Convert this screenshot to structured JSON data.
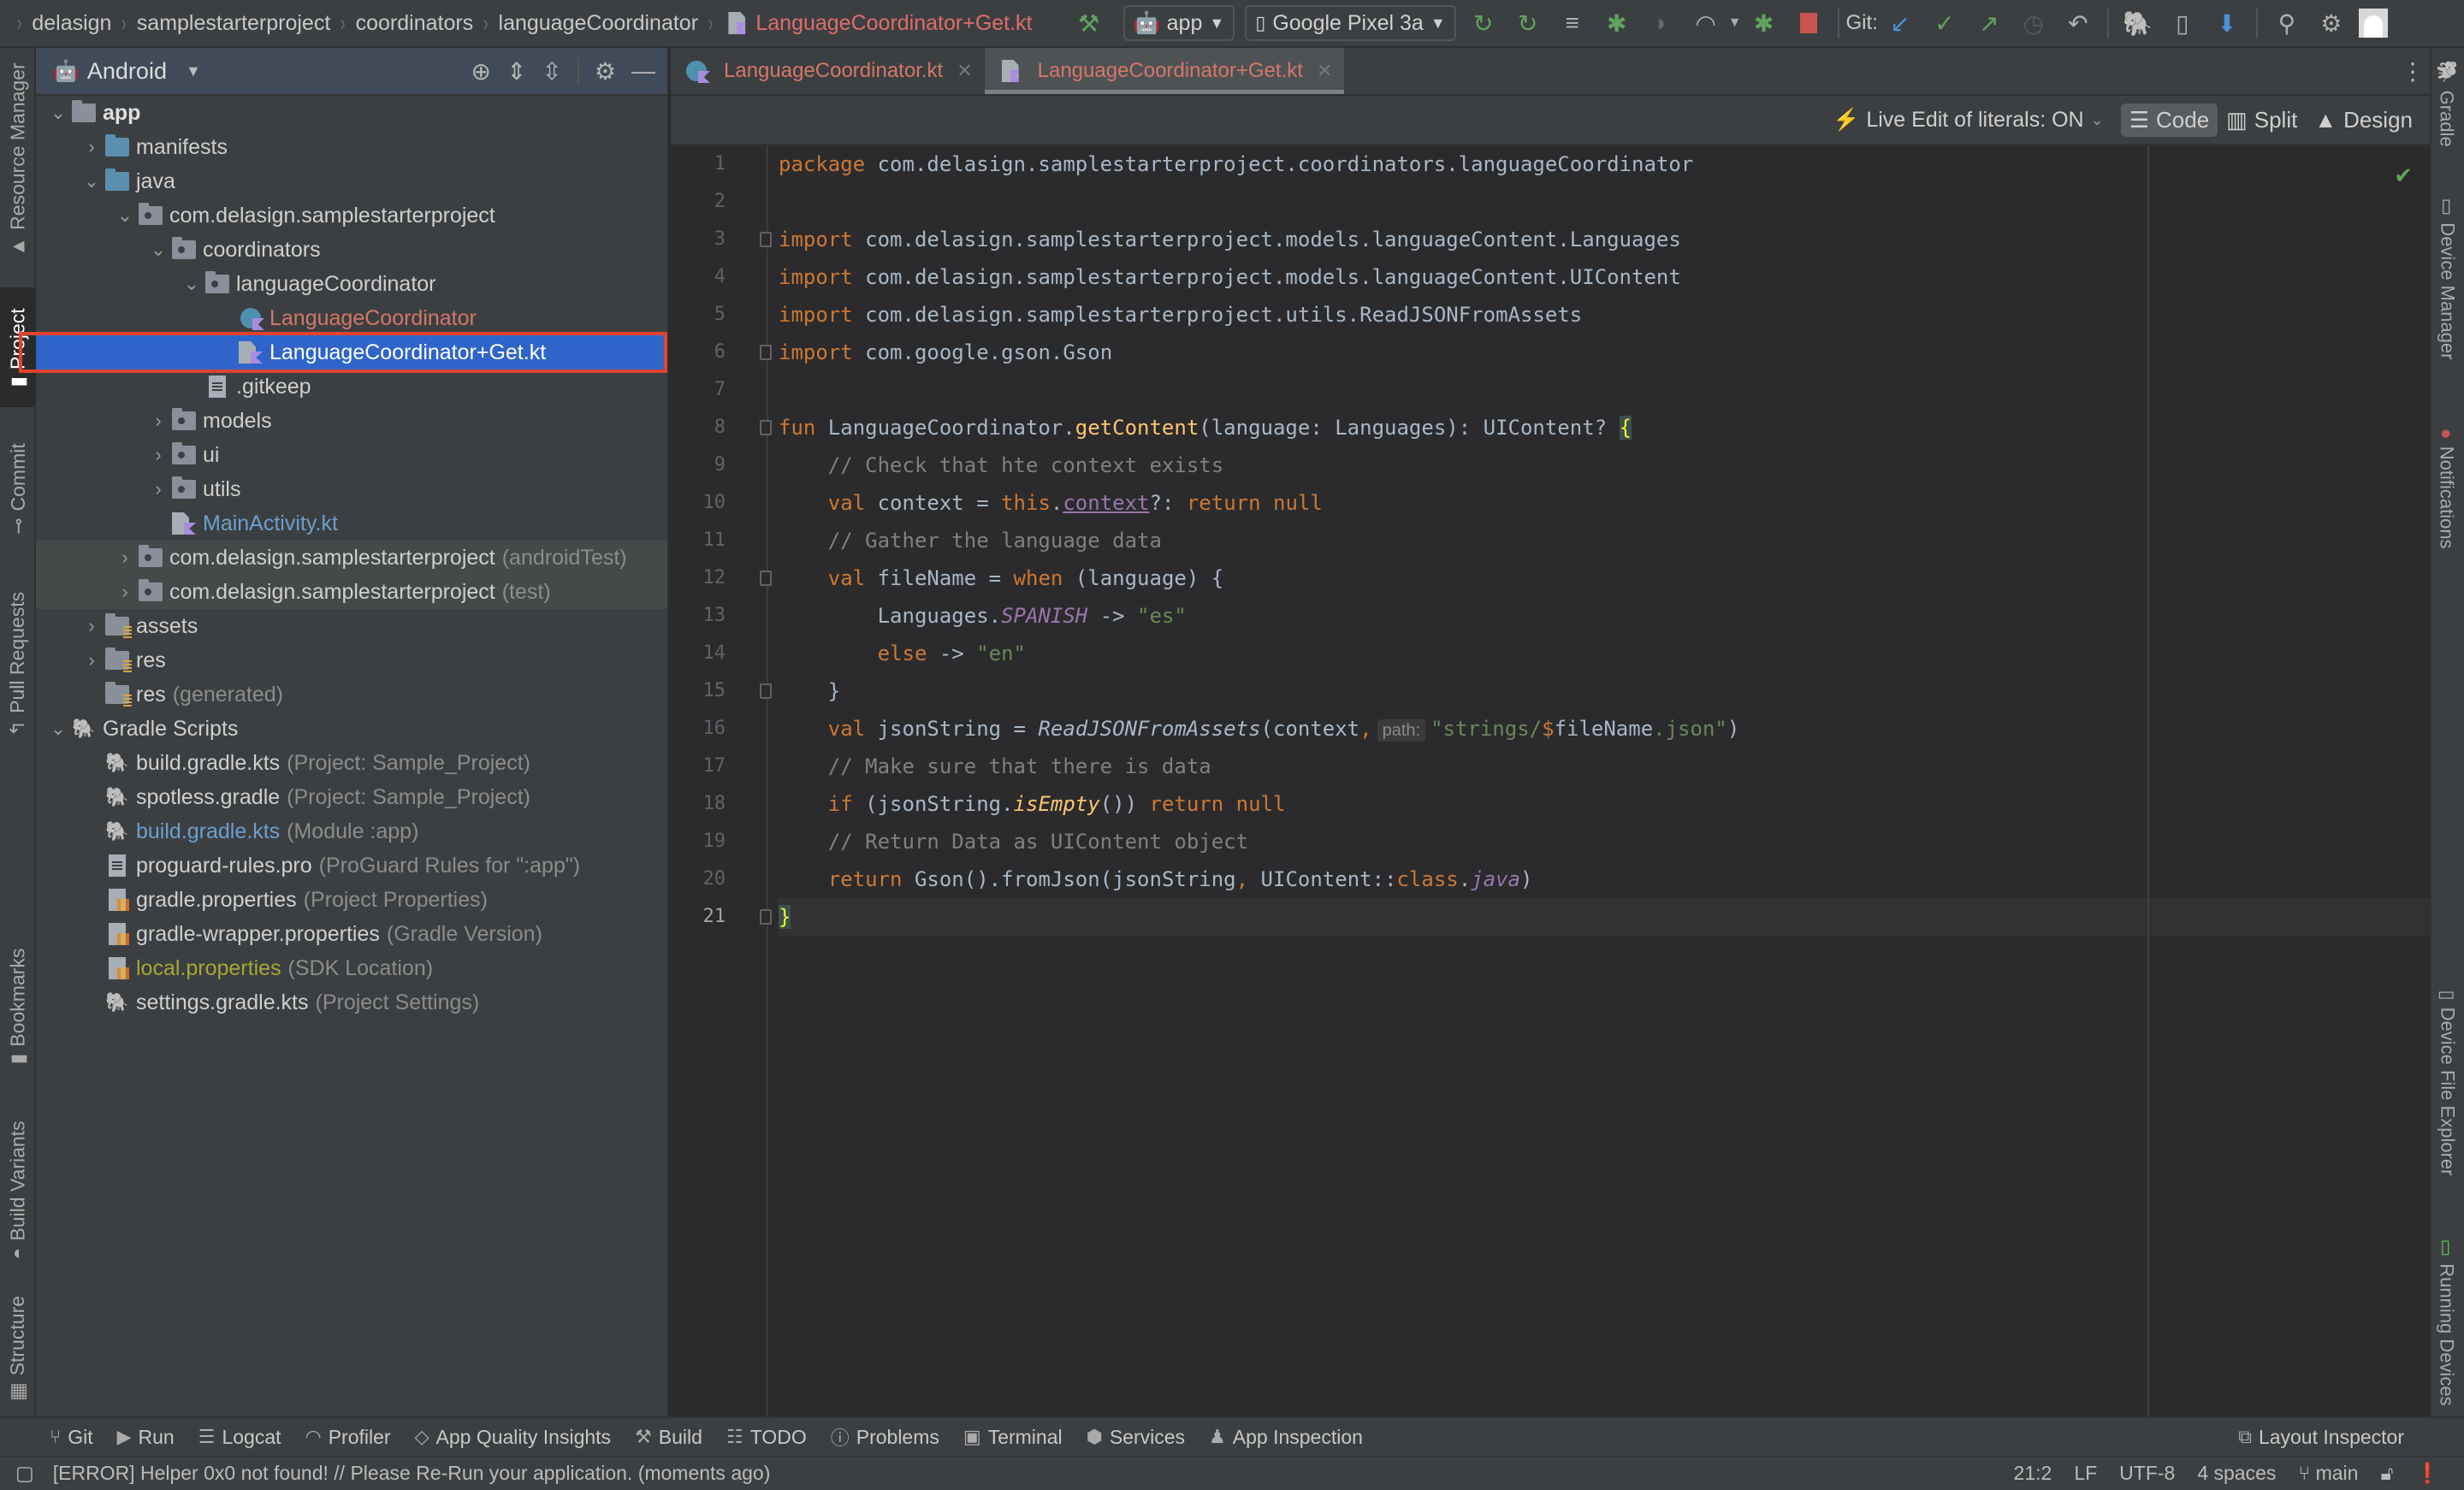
{
  "breadcrumbs": [
    "delasign",
    "samplestarterproject",
    "coordinators",
    "languageCoordinator",
    "LanguageCoordinator+Get.kt"
  ],
  "toolbar": {
    "run_config": "app",
    "device": "Google Pixel 3a",
    "git_label": "Git:",
    "icons": [
      "hammer-icon",
      "rerun-icon",
      "apply-changes-icon",
      "apply-code-changes-icon",
      "debug-icon",
      "attach-debugger-icon",
      "profile-icon",
      "attach-debug-icon",
      "stop-icon",
      "git-update-icon",
      "git-commit-icon",
      "git-push-icon",
      "history-icon",
      "rollback-icon",
      "gradle-sync-icon",
      "device-manager-icon",
      "sdk-manager-icon",
      "search-icon",
      "settings-icon",
      "avatar"
    ]
  },
  "left_tools": [
    "Resource Manager",
    "Project",
    "Commit",
    "Pull Requests",
    "Bookmarks",
    "Build Variants",
    "Structure"
  ],
  "right_tools": [
    "Gradle",
    "Device Manager",
    "Notifications",
    "Device File Explorer",
    "Running Devices"
  ],
  "project": {
    "view": "Android",
    "tree": [
      {
        "label": "app",
        "note": "",
        "depth": 0,
        "chev": "open",
        "icon": "module",
        "style": "bold"
      },
      {
        "label": "manifests",
        "note": "",
        "depth": 1,
        "chev": "closed",
        "icon": "src-folder",
        "style": ""
      },
      {
        "label": "java",
        "note": "",
        "depth": 1,
        "chev": "open",
        "icon": "src-folder",
        "style": ""
      },
      {
        "label": "com.delasign.samplestarterproject",
        "note": "",
        "depth": 2,
        "chev": "open",
        "icon": "package",
        "style": ""
      },
      {
        "label": "coordinators",
        "note": "",
        "depth": 3,
        "chev": "open",
        "icon": "package",
        "style": ""
      },
      {
        "label": "languageCoordinator",
        "note": "",
        "depth": 4,
        "chev": "open",
        "icon": "package",
        "style": ""
      },
      {
        "label": "LanguageCoordinator",
        "note": "",
        "depth": 5,
        "chev": "",
        "icon": "kotlin-class",
        "style": "red"
      },
      {
        "label": "LanguageCoordinator+Get.kt",
        "note": "",
        "depth": 5,
        "chev": "",
        "icon": "kotlin-file",
        "style": "selected"
      },
      {
        "label": ".gitkeep",
        "note": "",
        "depth": 4,
        "chev": "",
        "icon": "text-file",
        "style": ""
      },
      {
        "label": "models",
        "note": "",
        "depth": 3,
        "chev": "closed",
        "icon": "package",
        "style": ""
      },
      {
        "label": "ui",
        "note": "",
        "depth": 3,
        "chev": "closed",
        "icon": "package",
        "style": ""
      },
      {
        "label": "utils",
        "note": "",
        "depth": 3,
        "chev": "closed",
        "icon": "package",
        "style": ""
      },
      {
        "label": "MainActivity.kt",
        "note": "",
        "depth": 3,
        "chev": "",
        "icon": "kotlin-file",
        "style": "blue"
      },
      {
        "label": "com.delasign.samplestarterproject",
        "note": "(androidTest)",
        "depth": 2,
        "chev": "closed",
        "icon": "package",
        "style": "dim"
      },
      {
        "label": "com.delasign.samplestarterproject",
        "note": "(test)",
        "depth": 2,
        "chev": "closed",
        "icon": "package",
        "style": "dim"
      },
      {
        "label": "assets",
        "note": "",
        "depth": 1,
        "chev": "closed",
        "icon": "res-folder",
        "style": ""
      },
      {
        "label": "res",
        "note": "",
        "depth": 1,
        "chev": "closed",
        "icon": "res-folder",
        "style": ""
      },
      {
        "label": "res",
        "note": "(generated)",
        "depth": 1,
        "chev": "",
        "icon": "res-folder",
        "style": ""
      },
      {
        "label": "Gradle Scripts",
        "note": "",
        "depth": 0,
        "chev": "open",
        "icon": "gradle",
        "style": ""
      },
      {
        "label": "build.gradle.kts",
        "note": "(Project: Sample_Project)",
        "depth": 1,
        "chev": "",
        "icon": "gradle",
        "style": ""
      },
      {
        "label": "spotless.gradle",
        "note": "(Project: Sample_Project)",
        "depth": 1,
        "chev": "",
        "icon": "gradle",
        "style": ""
      },
      {
        "label": "build.gradle.kts",
        "note": "(Module :app)",
        "depth": 1,
        "chev": "",
        "icon": "gradle",
        "style": "blue"
      },
      {
        "label": "proguard-rules.pro",
        "note": "(ProGuard Rules for \":app\")",
        "depth": 1,
        "chev": "",
        "icon": "text-file",
        "style": ""
      },
      {
        "label": "gradle.properties",
        "note": "(Project Properties)",
        "depth": 1,
        "chev": "",
        "icon": "properties",
        "style": ""
      },
      {
        "label": "gradle-wrapper.properties",
        "note": "(Gradle Version)",
        "depth": 1,
        "chev": "",
        "icon": "properties",
        "style": ""
      },
      {
        "label": "local.properties",
        "note": "(SDK Location)",
        "depth": 1,
        "chev": "",
        "icon": "properties",
        "style": "olive"
      },
      {
        "label": "settings.gradle.kts",
        "note": "(Project Settings)",
        "depth": 1,
        "chev": "",
        "icon": "gradle",
        "style": ""
      }
    ]
  },
  "tabs": [
    {
      "label": "LanguageCoordinator.kt",
      "active": false
    },
    {
      "label": "LanguageCoordinator+Get.kt",
      "active": true
    }
  ],
  "editor_toolbar": {
    "live_edit": "Live Edit of literals: ON",
    "modes": [
      "Code",
      "Split",
      "Design"
    ],
    "active_mode": "Code"
  },
  "code": {
    "current_line": 21,
    "lines": [
      [
        [
          "kw",
          "package "
        ],
        [
          "",
          "com.delasign.samplestarterproject.coordinators.languageCoordinator"
        ]
      ],
      [],
      [
        [
          "kw",
          "import "
        ],
        [
          "",
          "com.delasign.samplestarterproject.models.languageContent.Languages"
        ]
      ],
      [
        [
          "kw",
          "import "
        ],
        [
          "",
          "com.delasign.samplestarterproject.models.languageContent.UIContent"
        ]
      ],
      [
        [
          "kw",
          "import "
        ],
        [
          "",
          "com.delasign.samplestarterproject.utils.ReadJSONFromAssets"
        ]
      ],
      [
        [
          "kw",
          "import "
        ],
        [
          "",
          "com.google.gson.Gson"
        ]
      ],
      [],
      [
        [
          "kw",
          "fun "
        ],
        [
          "",
          "LanguageCoordinator."
        ],
        [
          "fn",
          "getContent"
        ],
        [
          "",
          "(language: Languages): UIContent? "
        ],
        [
          "brace-hl",
          "{"
        ]
      ],
      [
        [
          "",
          "    "
        ],
        [
          "cm",
          "// Check that hte context exists"
        ]
      ],
      [
        [
          "",
          "    "
        ],
        [
          "kw",
          "val "
        ],
        [
          "",
          "context = "
        ],
        [
          "kw",
          "this"
        ],
        [
          "",
          "."
        ],
        [
          "ul",
          "context"
        ],
        [
          "",
          "",
          " "
        ],
        [
          "",
          "?: "
        ],
        [
          "kw",
          "return null"
        ]
      ],
      [
        [
          "",
          "    "
        ],
        [
          "cm",
          "// Gather the language data"
        ]
      ],
      [
        [
          "",
          "    "
        ],
        [
          "kw",
          "val "
        ],
        [
          "",
          "fileName = "
        ],
        [
          "kw",
          "when "
        ],
        [
          "",
          "(language) {"
        ]
      ],
      [
        [
          "",
          "        Languages."
        ],
        [
          "en",
          "SPANISH"
        ],
        [
          "",
          " -> "
        ],
        [
          "st",
          "\"es\""
        ]
      ],
      [
        [
          "",
          "        "
        ],
        [
          "kw",
          "else "
        ],
        [
          "",
          "-> "
        ],
        [
          "st",
          "\"en\""
        ]
      ],
      [
        [
          "",
          "    }"
        ]
      ],
      [
        [
          "",
          "    "
        ],
        [
          "kw",
          "val "
        ],
        [
          "",
          "jsonString = "
        ],
        [
          "it",
          "ReadJSONFromAssets"
        ],
        [
          "",
          "(context"
        ],
        [
          "kw",
          ","
        ],
        [
          "hint",
          "path:"
        ],
        [
          "st",
          "\"strings/"
        ],
        [
          "kw",
          "$"
        ],
        [
          "",
          "fileName"
        ],
        [
          "st",
          ".json\""
        ],
        [
          "",
          ")"
        ]
      ],
      [
        [
          "",
          "    "
        ],
        [
          "cm",
          "// Make sure that there is data"
        ]
      ],
      [
        [
          "",
          "    "
        ],
        [
          "kw",
          "if "
        ],
        [
          "",
          "(jsonString."
        ],
        [
          "fn it",
          "isEmpty"
        ],
        [
          "",
          "()) "
        ],
        [
          "kw",
          "return null"
        ]
      ],
      [
        [
          "",
          "    "
        ],
        [
          "cm",
          "// Return Data as UIContent object"
        ]
      ],
      [
        [
          "",
          "    "
        ],
        [
          "kw",
          "return "
        ],
        [
          "",
          "Gson().fromJson(jsonString"
        ],
        [
          "kw",
          ","
        ],
        [
          "",
          " UIContent::"
        ],
        [
          "kw",
          "class"
        ],
        [
          "",
          "."
        ],
        [
          "en",
          "java"
        ],
        [
          "",
          ")"
        ]
      ],
      [
        [
          "brace-hl",
          "}"
        ]
      ]
    ],
    "fold_lines": [
      3,
      6,
      8,
      12,
      15,
      21
    ]
  },
  "bottom_tools": [
    {
      "icon": "git-icon",
      "label": "Git"
    },
    {
      "icon": "run-icon",
      "label": "Run"
    },
    {
      "icon": "logcat-icon",
      "label": "Logcat"
    },
    {
      "icon": "profiler-icon",
      "label": "Profiler"
    },
    {
      "icon": "app-quality-icon",
      "label": "App Quality Insights"
    },
    {
      "icon": "build-icon",
      "label": "Build"
    },
    {
      "icon": "todo-icon",
      "label": "TODO"
    },
    {
      "icon": "problems-icon",
      "label": "Problems"
    },
    {
      "icon": "terminal-icon",
      "label": "Terminal"
    },
    {
      "icon": "services-icon",
      "label": "Services"
    },
    {
      "icon": "app-inspection-icon",
      "label": "App Inspection"
    }
  ],
  "layout_inspector": "Layout Inspector",
  "status": {
    "message": "[ERROR] Helper 0x0 not found! // Please Re-Run your application. (moments ago)",
    "position": "21:2",
    "line_sep": "LF",
    "encoding": "UTF-8",
    "indent": "4 spaces",
    "branch": "main"
  },
  "colors": {
    "accent_selection": "#2f65ca",
    "highlight_outline": "#e0442f",
    "keyword": "#cc7832",
    "string": "#6a8759",
    "comment": "#808080",
    "function": "#ffc66d"
  }
}
